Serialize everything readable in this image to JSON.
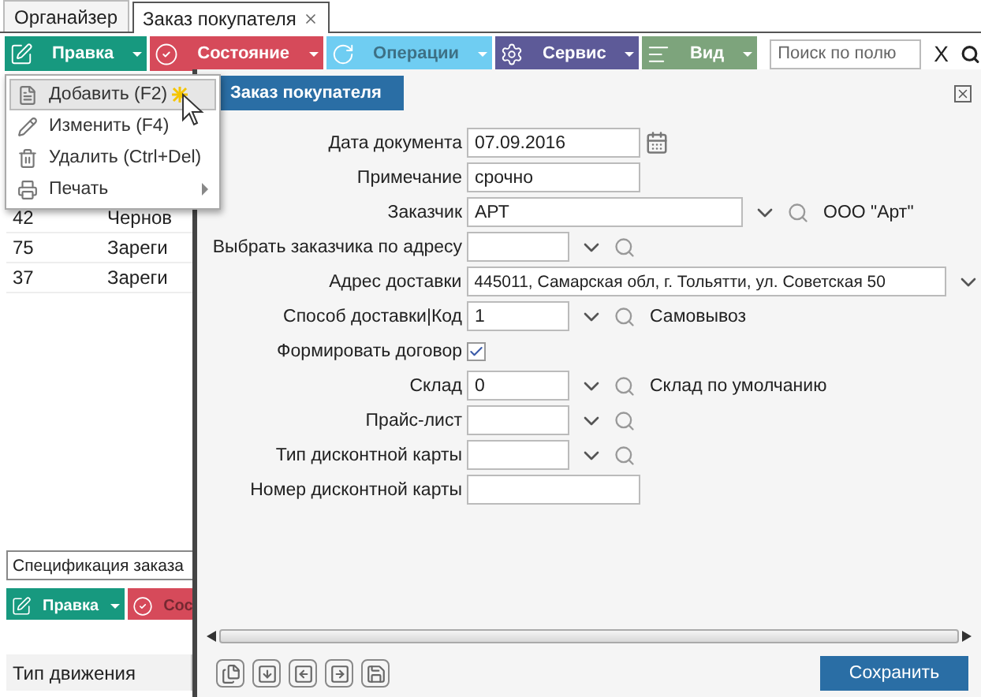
{
  "tabs": [
    {
      "label": "Органайзер",
      "selected": false,
      "closable": false
    },
    {
      "label": "Заказ покупателя",
      "selected": true,
      "closable": true
    }
  ],
  "toolbar": {
    "buttons": [
      {
        "label": "Правка",
        "color": "#17997f",
        "disabled": false
      },
      {
        "label": "Состояние",
        "color": "#d64a5a",
        "disabled": false
      },
      {
        "label": "Операции",
        "color": "#6fcdf2",
        "disabled": true
      },
      {
        "label": "Сервис",
        "color": "#5d5a98",
        "disabled": false
      },
      {
        "label": "Вид",
        "color": "#7da47c",
        "disabled": false
      }
    ],
    "search": {
      "placeholder": "Поиск по полю"
    },
    "clear": "X"
  },
  "grid": {
    "rows": [
      {
        "column_1": "42",
        "column_2": "Чернов"
      },
      {
        "column_1": "75",
        "column_2": "Зареги"
      },
      {
        "column_1": "37",
        "column_2": "Зареги"
      }
    ]
  },
  "menu": {
    "items": [
      {
        "label": "Добавить (F2)",
        "kind": "add",
        "selected": true,
        "submenu": false
      },
      {
        "label": "Изменить (F4)",
        "kind": "edit",
        "selected": false,
        "submenu": false
      },
      {
        "label": "Удалить (Ctrl+Del)",
        "kind": "delete",
        "selected": false,
        "submenu": false
      },
      {
        "label": "Печать",
        "kind": "print",
        "selected": false,
        "submenu": true
      }
    ]
  },
  "detail_panel": {
    "title": "Спецификация заказа",
    "toolbar": [
      {
        "label": "Правка",
        "color": "#17997f",
        "disabled": false
      },
      {
        "label": "Сос",
        "color": "#d64a5a",
        "disabled": true
      }
    ],
    "columns": [
      "Тип движения"
    ]
  },
  "dialog": {
    "title": "Заказ покупателя",
    "fields": [
      {
        "label": "Дата документа",
        "kind": "date",
        "value": "07.09.2016"
      },
      {
        "label": "Примечание",
        "kind": "text",
        "value": "срочно"
      },
      {
        "label": "Заказчик",
        "kind": "lookup_wide",
        "value": "АРТ",
        "note": "ООО \"Арт\""
      },
      {
        "label": "Выбрать заказчика по адресу",
        "kind": "lookup"
      },
      {
        "label": "Адрес доставки",
        "kind": "address",
        "value": "445011, Самарская обл, г. Тольятти, ул. Советская 50"
      },
      {
        "label": "Способ доставки|Код",
        "kind": "lookup",
        "value": "1",
        "note": "Самовывоз"
      },
      {
        "label": "Формировать договор",
        "kind": "checkbox",
        "checked": true
      },
      {
        "label": "Склад",
        "kind": "lookup",
        "value": "0",
        "note": "Склад по умолчанию"
      },
      {
        "label": "Прайс-лист",
        "kind": "lookup"
      },
      {
        "label": "Тип дисконтной карты",
        "kind": "lookup"
      },
      {
        "label": "Номер дисконтной карты",
        "kind": "text"
      }
    ],
    "save_button": "Сохранить"
  }
}
